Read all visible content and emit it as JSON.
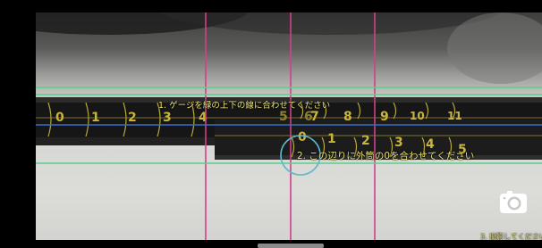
{
  "guides": {
    "align_lines_hint": "1. ゲージを緑の上下の線に合わせてください",
    "align_zero_hint": "2. この辺りに外筒の0を合わせてください",
    "shoot_hint": "3. 撮影してください"
  },
  "gauge": {
    "outer_scale": [
      "0",
      "1",
      "2",
      "3",
      "4",
      "5",
      "6",
      "7",
      "8",
      "9",
      "10",
      "11"
    ],
    "inner_scale": [
      "0",
      "1",
      "2",
      "3",
      "4",
      "5"
    ]
  },
  "controls": {
    "camera_icon": "camera-icon"
  },
  "colors": {
    "green_guide": "#58d08a",
    "pink_guide": "#d0408a",
    "blue_guide": "#3b6cc9",
    "circle_guide": "#5fb7c9",
    "hint_text": "#ece27a"
  }
}
